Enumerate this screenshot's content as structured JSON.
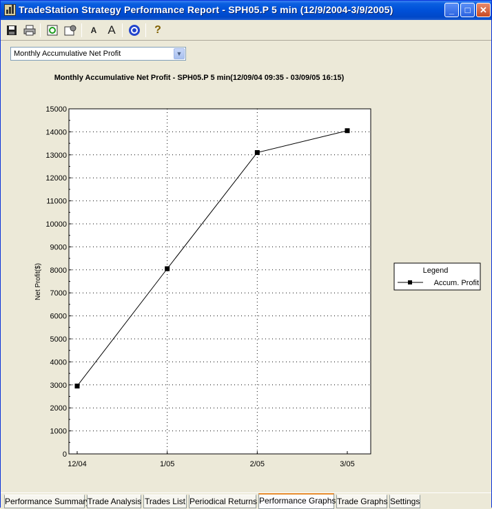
{
  "window": {
    "title": "TradeStation Strategy Performance Report - SPH05.P 5 min (12/9/2004-3/9/2005)",
    "controls": {
      "minimize": "_",
      "maximize": "□",
      "close": "✕"
    }
  },
  "toolbar": {
    "icons": [
      "save-icon",
      "print-icon",
      "refresh-icon",
      "settings-icon",
      "font-decrease-icon",
      "font-increase-icon",
      "target-icon",
      "help-icon"
    ],
    "font_small_label": "A",
    "font_large_label": "A",
    "help_label": "?"
  },
  "selector": {
    "value": "Monthly Accumulative Net Profit",
    "arrow": "▼"
  },
  "chart_data": {
    "type": "line",
    "title": "Monthly Accumulative Net Profit - SPH05.P 5 min(12/09/04 09:35 - 03/09/05 16:15)",
    "xlabel": "",
    "ylabel": "Net Profit($)",
    "categories": [
      "12/04",
      "1/05",
      "2/05",
      "3/05"
    ],
    "series": [
      {
        "name": "Accum. Profit",
        "values": [
          2950,
          8050,
          13100,
          14050
        ],
        "marker": "square",
        "color": "#000000"
      }
    ],
    "ylim": [
      0,
      15000
    ],
    "yticks": [
      0,
      1000,
      2000,
      3000,
      4000,
      5000,
      6000,
      7000,
      8000,
      9000,
      10000,
      11000,
      12000,
      13000,
      14000,
      15000
    ],
    "grid": "dotted",
    "legend": {
      "title": "Legend",
      "placement": "right"
    }
  },
  "tabs": [
    {
      "label": "Performance Summary",
      "active": false
    },
    {
      "label": "Trade Analysis",
      "active": false
    },
    {
      "label": "Trades List",
      "active": false
    },
    {
      "label": "Periodical Returns",
      "active": false
    },
    {
      "label": "Performance Graphs",
      "active": true
    },
    {
      "label": "Trade Graphs",
      "active": false
    },
    {
      "label": "Settings",
      "active": false
    }
  ]
}
